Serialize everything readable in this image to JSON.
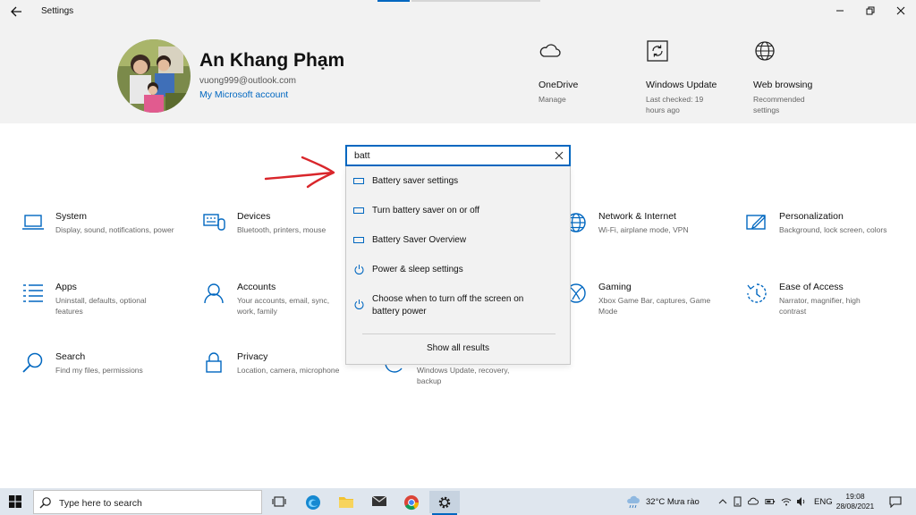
{
  "window": {
    "title": "Settings"
  },
  "user": {
    "name": "An Khang Phạm",
    "email": "vuong999@outlook.com",
    "account_link": "My Microsoft account"
  },
  "quick_links": [
    {
      "icon": "cloud-icon",
      "title": "OneDrive",
      "subtitle": "Manage"
    },
    {
      "icon": "windows-update-icon",
      "title": "Windows Update",
      "subtitle": "Last checked: 19 hours ago"
    },
    {
      "icon": "globe-icon",
      "title": "Web browsing",
      "subtitle": "Recommended settings"
    }
  ],
  "tiles": [
    {
      "icon": "laptop-icon",
      "title": "System",
      "subtitle": "Display, sound, notifications, power"
    },
    {
      "icon": "devices-icon",
      "title": "Devices",
      "subtitle": "Bluetooth, printers, mouse"
    },
    {
      "icon": "globe-icon",
      "title": "Network & Internet",
      "subtitle": "Wi-Fi, airplane mode, VPN"
    },
    {
      "icon": "personalization-icon",
      "title": "Personalization",
      "subtitle": "Background, lock screen, colors"
    },
    {
      "icon": "apps-icon",
      "title": "Apps",
      "subtitle": "Uninstall, defaults, optional features"
    },
    {
      "icon": "person-icon",
      "title": "Accounts",
      "subtitle": "Your accounts, email, sync, work, family"
    },
    {
      "icon": "xbox-icon",
      "title": "Gaming",
      "subtitle": "Xbox Game Bar, captures, Game Mode"
    },
    {
      "icon": "ease-of-access-icon",
      "title": "Ease of Access",
      "subtitle": "Narrator, magnifier, high contrast"
    },
    {
      "icon": "search-icon",
      "title": "Search",
      "subtitle": "Find my files, permissions"
    },
    {
      "icon": "lock-icon",
      "title": "Privacy",
      "subtitle": "Location, camera, microphone"
    },
    {
      "icon": "update-icon",
      "title": "",
      "subtitle": "Windows Update, recovery, backup"
    }
  ],
  "search": {
    "value": "batt",
    "results": [
      {
        "icon": "battery-icon",
        "label": "Battery saver settings"
      },
      {
        "icon": "battery-icon",
        "label": "Turn battery saver on or off"
      },
      {
        "icon": "battery-icon",
        "label": "Battery Saver Overview"
      },
      {
        "icon": "power-icon",
        "label": "Power & sleep settings"
      },
      {
        "icon": "power-icon",
        "label": "Choose when to turn off the screen on battery power"
      }
    ],
    "show_all": "Show all results"
  },
  "taskbar": {
    "search_placeholder": "Type here to search",
    "weather": "32°C  Mưa rào",
    "language": "ENG",
    "time": "19:08",
    "date": "28/08/2021"
  },
  "colors": {
    "accent": "#0067c0",
    "annotation_arrow": "#d9262b"
  }
}
